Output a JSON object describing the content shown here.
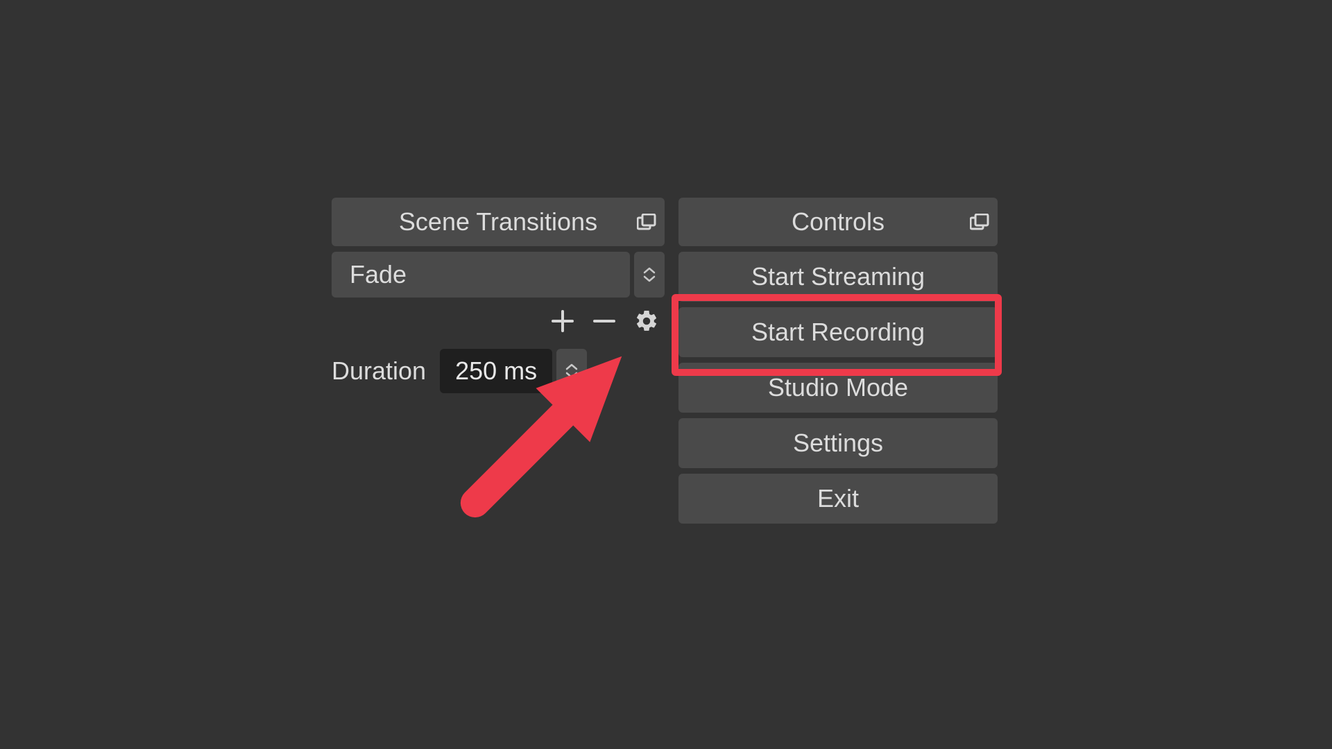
{
  "transitions": {
    "header": "Scene Transitions",
    "selected": "Fade",
    "duration_label": "Duration",
    "duration_value": "250 ms"
  },
  "controls": {
    "header": "Controls",
    "buttons": {
      "start_streaming": "Start Streaming",
      "start_recording": "Start Recording",
      "studio_mode": "Studio Mode",
      "settings": "Settings",
      "exit": "Exit"
    }
  },
  "annotation": {
    "highlight_color": "#ee3a4a"
  }
}
